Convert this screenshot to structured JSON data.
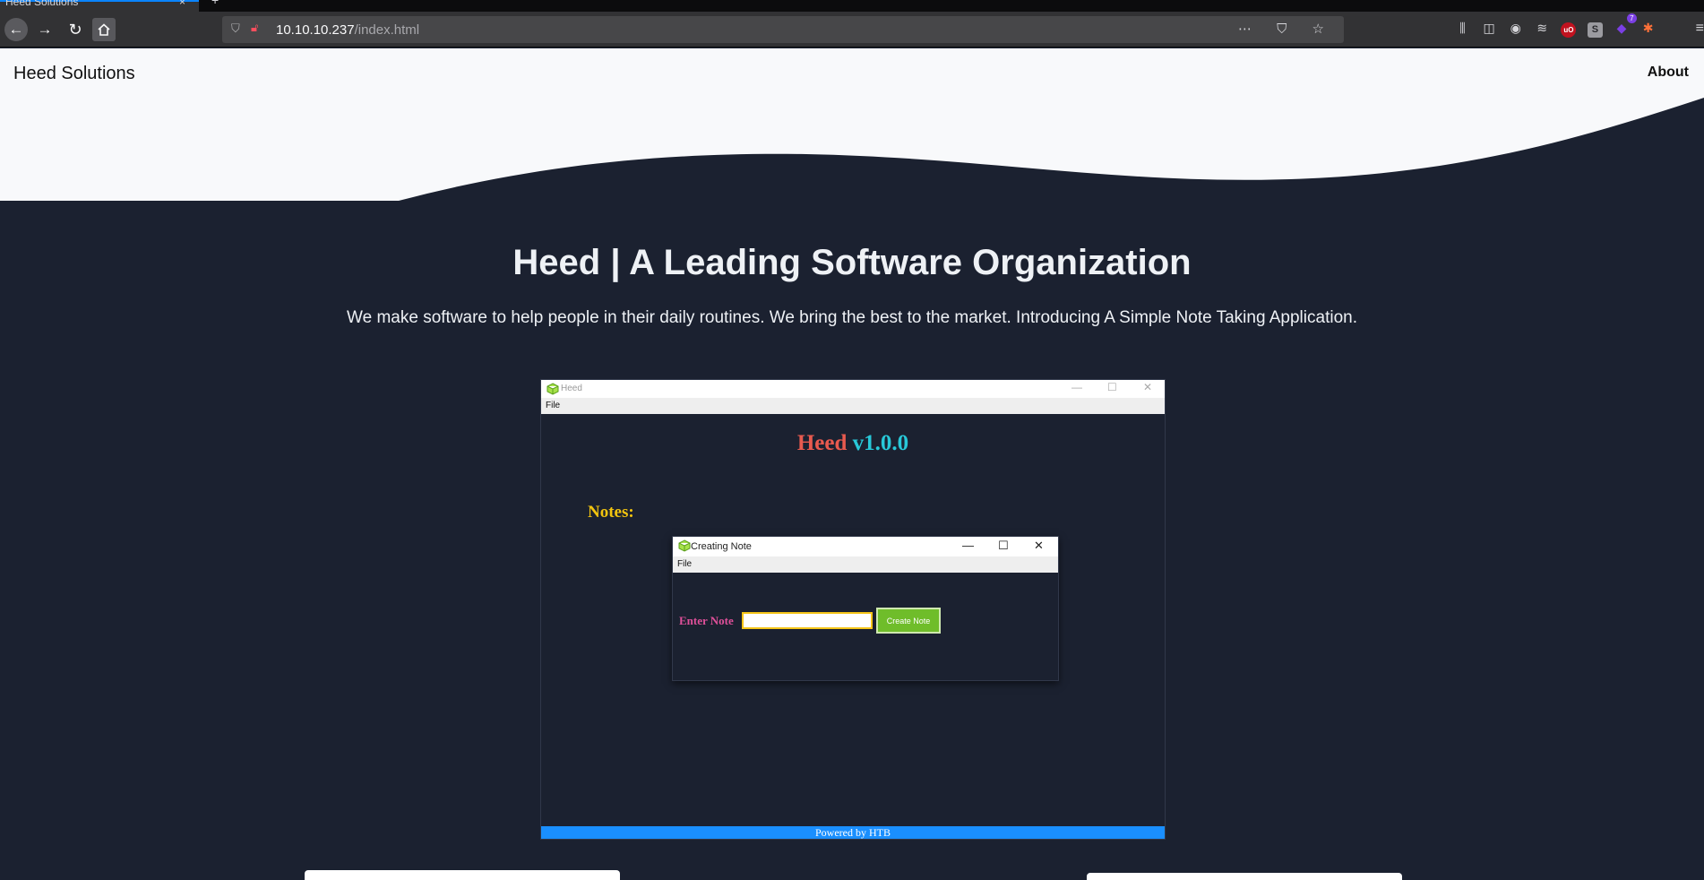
{
  "browser": {
    "tab_title": "Heed Solutions",
    "tab_close": "×",
    "new_tab": "+",
    "url_host": "10.10.10.237",
    "url_path": "/index.html",
    "url_actions": "⋯ ⛉ ☆",
    "extension_badge": "7"
  },
  "site": {
    "brand": "Heed Solutions",
    "nav_about": "About",
    "headline": "Heed | A Leading Software Organization",
    "tagline": "We make software to help people in their daily routines. We bring the best to the market. Introducing A Simple Note Taking Application."
  },
  "app_screenshot": {
    "window_title": "Heed",
    "menu_file": "File",
    "app_name": "Heed",
    "app_version": "v1.0.0",
    "notes_label": "Notes:",
    "footer": "Powered by HTB",
    "dialog": {
      "title": "Creating Note",
      "menu_file": "File",
      "enter_label": "Enter Note",
      "input_value": "",
      "button_label": "Create Note"
    }
  },
  "colors": {
    "page_bg": "#1b2130",
    "hero_bg": "#f8f9fb",
    "app_title_accent": "#e85a4f",
    "app_version_accent": "#28c8d8",
    "notes_label": "#f2c40f",
    "enter_label": "#e0509a",
    "button_bg": "#6fbd2a",
    "footer_bar": "#1a8fff"
  }
}
